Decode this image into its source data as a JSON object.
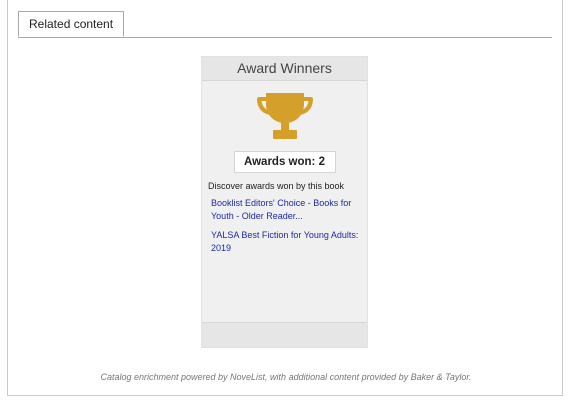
{
  "tabs": [
    {
      "label": "Related content"
    }
  ],
  "widget": {
    "title": "Award Winners",
    "icon": "trophy-icon",
    "trophy_color": "#d4a02a",
    "awards_count": "Awards won: 2",
    "discover_text": "Discover awards won by this book",
    "awards": [
      {
        "label": "Booklist Editors' Choice - Books for Youth - Older Reader..."
      },
      {
        "label": "YALSA Best Fiction for Young Adults: 2019"
      }
    ]
  },
  "footer": {
    "credit": "Catalog enrichment powered by NoveList, with additional content provided by Baker & Taylor."
  }
}
